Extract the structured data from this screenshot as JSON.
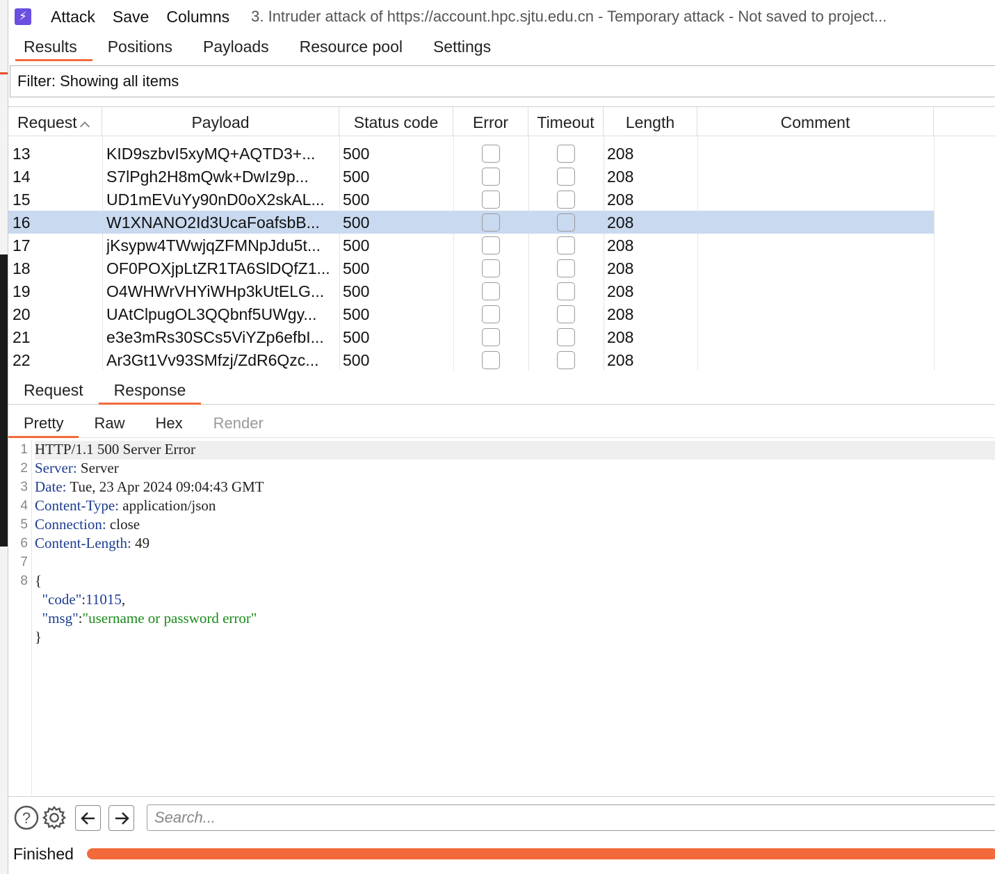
{
  "app": {
    "menu": [
      "Attack",
      "Save",
      "Columns"
    ],
    "window_title": "3. Intruder attack of https://account.hpc.sjtu.edu.cn - Temporary attack - Not saved to project..."
  },
  "main_tabs": [
    "Results",
    "Positions",
    "Payloads",
    "Resource pool",
    "Settings"
  ],
  "active_main_tab": "Results",
  "filter": {
    "text": "Filter: Showing all items"
  },
  "table": {
    "columns": [
      "Request",
      "Payload",
      "Status code",
      "Error",
      "Timeout",
      "Length",
      "Comment"
    ],
    "sorted_column": "Request",
    "sort_direction": "ascending",
    "rows": [
      {
        "request": "13",
        "payload": "KID9szbvI5xyMQ+AQTD3+...",
        "status": "500",
        "error": false,
        "timeout": false,
        "length": "208",
        "comment": "",
        "selected": false
      },
      {
        "request": "14",
        "payload": "S7lPgh2H8mQwk+DwIz9p...",
        "status": "500",
        "error": false,
        "timeout": false,
        "length": "208",
        "comment": "",
        "selected": false
      },
      {
        "request": "15",
        "payload": "UD1mEVuYy90nD0oX2skAL...",
        "status": "500",
        "error": false,
        "timeout": false,
        "length": "208",
        "comment": "",
        "selected": false
      },
      {
        "request": "16",
        "payload": "W1XNANO2Id3UcaFoafsbB...",
        "status": "500",
        "error": false,
        "timeout": false,
        "length": "208",
        "comment": "",
        "selected": true
      },
      {
        "request": "17",
        "payload": "jKsypw4TWwjqZFMNpJdu5t...",
        "status": "500",
        "error": false,
        "timeout": false,
        "length": "208",
        "comment": "",
        "selected": false
      },
      {
        "request": "18",
        "payload": "OF0POXjpLtZR1TA6SlDQfZ1...",
        "status": "500",
        "error": false,
        "timeout": false,
        "length": "208",
        "comment": "",
        "selected": false
      },
      {
        "request": "19",
        "payload": "O4WHWrVHYiWHp3kUtELG...",
        "status": "500",
        "error": false,
        "timeout": false,
        "length": "208",
        "comment": "",
        "selected": false
      },
      {
        "request": "20",
        "payload": "UAtClpugOL3QQbnf5UWgy...",
        "status": "500",
        "error": false,
        "timeout": false,
        "length": "208",
        "comment": "",
        "selected": false
      },
      {
        "request": "21",
        "payload": "e3e3mRs30SCs5ViYZp6efbI...",
        "status": "500",
        "error": false,
        "timeout": false,
        "length": "208",
        "comment": "",
        "selected": false
      },
      {
        "request": "22",
        "payload": "Ar3Gt1Vv93SMfzj/ZdR6Qzc...",
        "status": "500",
        "error": false,
        "timeout": false,
        "length": "208",
        "comment": "",
        "selected": false
      }
    ]
  },
  "message_tabs": [
    "Request",
    "Response"
  ],
  "active_message_tab": "Response",
  "view_tabs": [
    "Pretty",
    "Raw",
    "Hex",
    "Render"
  ],
  "active_view_tab": "Pretty",
  "response": {
    "status_line": "HTTP/1.1 500 Server Error",
    "headers": [
      {
        "name": "Server",
        "value": "Server"
      },
      {
        "name": "Date",
        "value": "Tue, 23 Apr 2024 09:04:43 GMT"
      },
      {
        "name": "Content-Type",
        "value": "application/json"
      },
      {
        "name": "Connection",
        "value": "close"
      },
      {
        "name": "Content-Length",
        "value": "49"
      }
    ],
    "body_open": "{",
    "body_code_key": "\"code\"",
    "body_code_value": "11015",
    "body_msg_key": "\"msg\"",
    "body_msg_value": "\"username or password error\"",
    "body_close": "}",
    "line_numbers": [
      "1",
      "2",
      "3",
      "4",
      "5",
      "6",
      "7",
      "8"
    ]
  },
  "search": {
    "placeholder": "Search..."
  },
  "status": {
    "text": "Finished",
    "progress": 1.0
  },
  "colors": {
    "accent": "#f26a3a",
    "selection": "#c9d9ef",
    "app_icon": "#6b4fe0",
    "json_string": "#1a8a1a",
    "header_key": "#1d3d8f"
  },
  "icons": {
    "app": "burp-lightning-icon",
    "help": "question-circle-icon",
    "settings": "gear-icon",
    "back": "arrow-left-icon",
    "forward": "arrow-right-icon",
    "sort": "chevron-up-icon"
  }
}
